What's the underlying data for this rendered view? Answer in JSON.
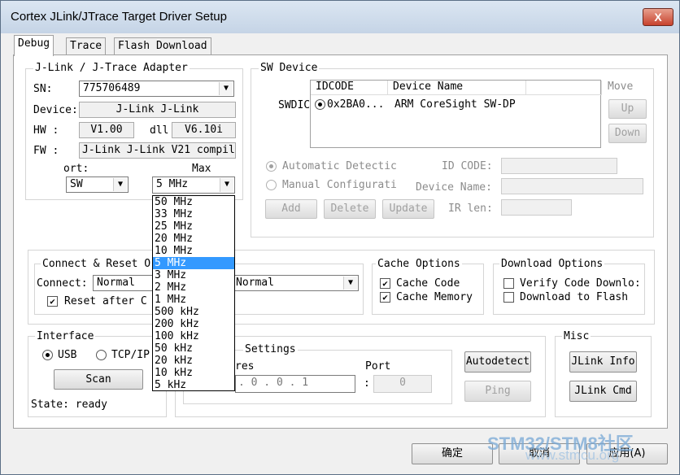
{
  "window": {
    "title": "Cortex JLink/JTrace Target Driver Setup",
    "close": "X"
  },
  "tabs": [
    "Debug",
    "Trace",
    "Flash Download"
  ],
  "adapter": {
    "title": "J-Link / J-Trace Adapter",
    "sn_label": "SN:",
    "sn_value": "775706489",
    "device_label": "Device:",
    "device_value": "J-Link J-Link",
    "hw_label": "HW :",
    "hw_value": "V1.00",
    "dll_label": "dll",
    "dll_value": "V6.10i",
    "fw_label": "FW :",
    "fw_value": "J-Link J-Link V21 compil",
    "port_label": "ort:",
    "port_value": "SW",
    "max_label": "Max",
    "max_value": "5 MHz"
  },
  "max_clock_options": [
    "50 MHz",
    "33 MHz",
    "25 MHz",
    "20 MHz",
    "10 MHz",
    "5 MHz",
    "3 MHz",
    "2 MHz",
    "1 MHz",
    "500 kHz",
    "200 kHz",
    "100 kHz",
    "50 kHz",
    "20 kHz",
    "10 kHz",
    "5 kHz"
  ],
  "max_clock_selected": "5 MHz",
  "sw_device": {
    "title": "SW Device",
    "swdio_label": "SWDIC",
    "columns": [
      "IDCODE",
      "Device Name"
    ],
    "rows": [
      {
        "idcode": "0x2BA0...",
        "name": "ARM CoreSight SW-DP"
      }
    ],
    "move_label": "Move",
    "up": "Up",
    "down": "Down",
    "auto_detect": "Automatic Detectic",
    "manual_config": "Manual Configurati",
    "id_code_label": "ID CODE:",
    "device_name_label": "Device Name:",
    "ir_len_label": "IR len:",
    "add": "Add",
    "delete": "Delete",
    "update": "Update"
  },
  "connect_reset": {
    "title": "Connect & Reset O",
    "connect_label": "Connect:",
    "connect_value": "Normal",
    "reset_value": "Normal",
    "reset_after": "Reset after C"
  },
  "cache": {
    "title": "Cache Options",
    "code": "Cache Code",
    "memory": "Cache Memory"
  },
  "download": {
    "title": "Download Options",
    "verify": "Verify Code Downlo:",
    "to_flash": "Download to Flash"
  },
  "interface": {
    "title": "Interface",
    "usb": "USB",
    "tcpip": "TCP/IP",
    "scan": "Scan",
    "state": "State: ready"
  },
  "tcpip": {
    "title": "Settings",
    "address_label": "res",
    "address_value": ". 0 . 0 . 1",
    "port_label": "Port",
    "port_value": "0",
    "colon": ":",
    "autodetect": "Autodetect",
    "ping": "Ping"
  },
  "misc": {
    "title": "Misc",
    "info": "JLink Info",
    "cmd": "JLink Cmd"
  },
  "footer": {
    "ok": "确定",
    "cancel": "取消",
    "apply": "应用(A)"
  },
  "watermark": {
    "line1": "STM32/STM8社区",
    "line2": "www.stmcu.org"
  }
}
